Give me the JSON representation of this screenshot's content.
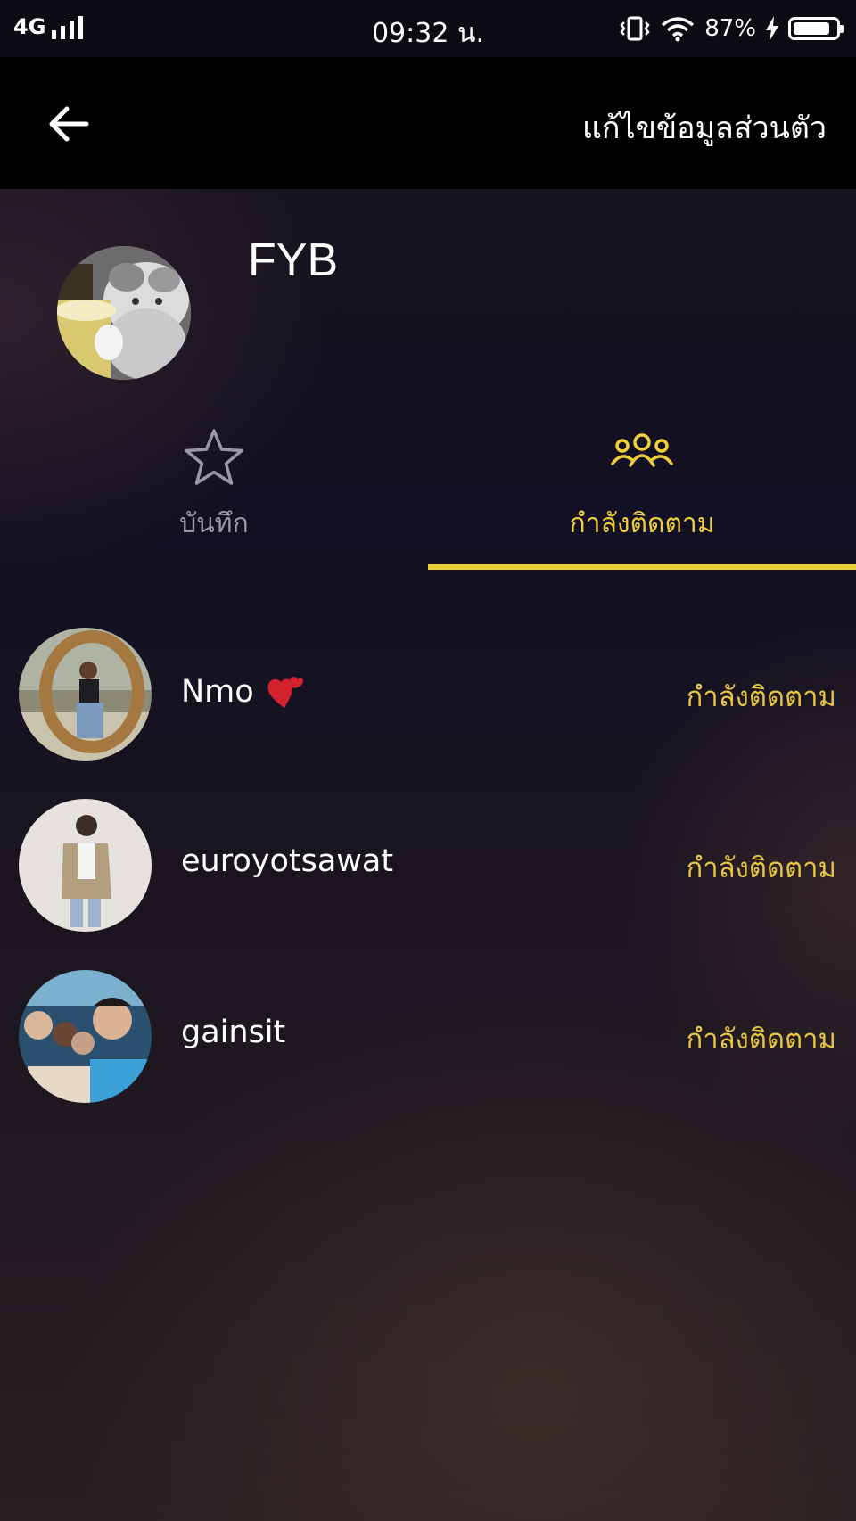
{
  "status_bar": {
    "network": "4G",
    "time": "09:32 น.",
    "battery_percent": "87%",
    "battery_level": 0.87
  },
  "header": {
    "edit_profile_label": "แก้ไขข้อมูลส่วนตัว"
  },
  "profile": {
    "name": "FYB"
  },
  "tabs": [
    {
      "label": "บันทึก",
      "icon": "star-icon",
      "active": false
    },
    {
      "label": "กำลังติดตาม",
      "icon": "users-icon",
      "active": true
    }
  ],
  "following": [
    {
      "name": "Nmo",
      "emoji": "two-hearts-icon",
      "action": "กำลังติดตาม"
    },
    {
      "name": "euroyotsawat",
      "action": "กำลังติดตาม"
    },
    {
      "name": "gainsit",
      "action": "กำลังติดตาม"
    }
  ],
  "colors": {
    "accent": "#e9cf3c",
    "header_bg": "#000000",
    "inactive_tab": "#9a96a4"
  }
}
